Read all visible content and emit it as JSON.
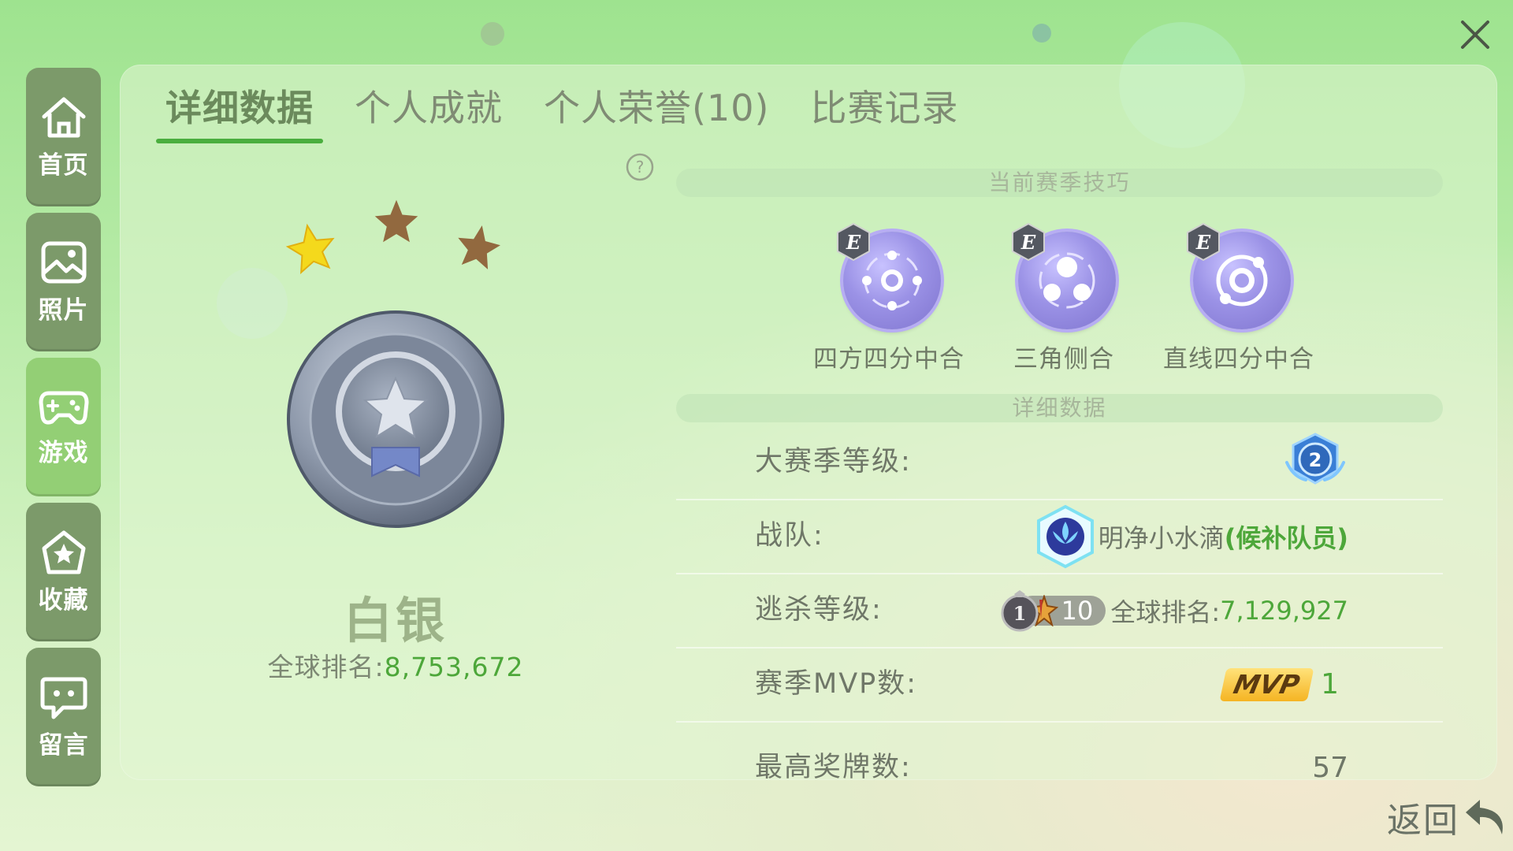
{
  "tabs": [
    {
      "label": "详细数据",
      "active": true
    },
    {
      "label": "个人成就",
      "active": false
    },
    {
      "label": "个人荣誉(10)",
      "active": false
    },
    {
      "label": "比赛记录",
      "active": false
    }
  ],
  "sidebar": [
    {
      "label": "首页",
      "icon": "home-icon"
    },
    {
      "label": "照片",
      "icon": "photo-icon"
    },
    {
      "label": "游戏",
      "icon": "gamepad-icon",
      "active": true
    },
    {
      "label": "收藏",
      "icon": "favorite-icon"
    },
    {
      "label": "留言",
      "icon": "message-icon"
    }
  ],
  "rank": {
    "stars_filled": 1,
    "stars_total": 3,
    "name": "白银",
    "global_label": "全球排名:",
    "global_value": "8,753,672"
  },
  "skills": {
    "header": "当前赛季技巧",
    "items": [
      {
        "grade": "E",
        "label": "四方四分中合"
      },
      {
        "grade": "E",
        "label": "三角侧合"
      },
      {
        "grade": "E",
        "label": "直线四分中合"
      }
    ]
  },
  "details": {
    "header": "详细数据",
    "season_level": {
      "label": "大赛季等级:",
      "value": "2"
    },
    "team": {
      "label": "战队:",
      "name": "明净小水滴",
      "role": "(候补队员)"
    },
    "escape": {
      "label": "逃杀等级:",
      "tier": "1",
      "level": "10",
      "rank_label": "全球排名:",
      "rank_value": "7,129,927"
    },
    "mvp": {
      "label": "赛季MVP数:",
      "badge": "MVP",
      "value": "1"
    },
    "medals": {
      "label": "最高奖牌数:",
      "value": "57"
    }
  },
  "back_label": "返回",
  "colors": {
    "accent_green": "#4da73a",
    "tab_underline": "#4aae3e",
    "sidebar_bg": "#7c9a6a",
    "sidebar_active": "#93cf75"
  }
}
